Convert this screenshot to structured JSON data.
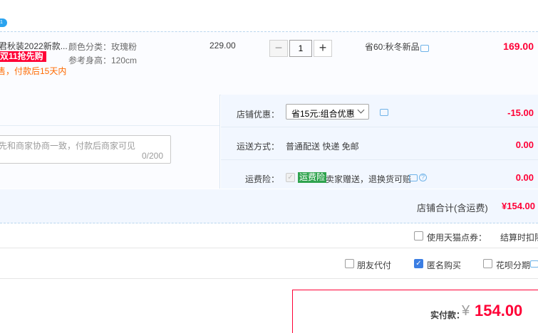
{
  "header": {
    "badge": "1"
  },
  "item": {
    "title": "君秋装2022新款...",
    "promo_tag": "双11抢先购",
    "presale_note": "售，付款后15天内",
    "sku_color": "颜色分类：玫瑰粉",
    "sku_height": "参考身高：120cm",
    "unit_price": "229.00",
    "quantity": "1",
    "qty_minus": "−",
    "qty_plus": "+",
    "discount": "省60:秋冬新品",
    "subtotal": "169.00"
  },
  "message": {
    "placeholder": "先和商家协商一致，付款后商家可见",
    "counter": "0/200"
  },
  "shop_discount": {
    "label": "店铺优惠：",
    "selected": "省15元:组合优惠",
    "amount": "-15.00"
  },
  "shipping": {
    "label": "运送方式：",
    "value": "普通配送 快递 免邮",
    "amount": "0.00"
  },
  "insurance": {
    "label": "运费险：",
    "tag": "运费险",
    "desc": "卖家赠送，退换货可赔",
    "amount": "0.00"
  },
  "shop_total": {
    "label": "店铺合计(含运费)",
    "amount": "¥154.00"
  },
  "options": {
    "tmall_points": "使用天猫点券：",
    "settle_note": "结算时扣除",
    "friend_pay": "朋友代付",
    "anonymous": "匿名购买",
    "huabei": "花呗分期"
  },
  "payment": {
    "label": "实付款：",
    "currency": "¥",
    "amount": "154.00"
  },
  "colors": {
    "accent_red": "#ff0036",
    "link_blue": "#3b7ee3",
    "panel_bg": "#f2f7ff",
    "insurance_green": "#2fa34e"
  }
}
